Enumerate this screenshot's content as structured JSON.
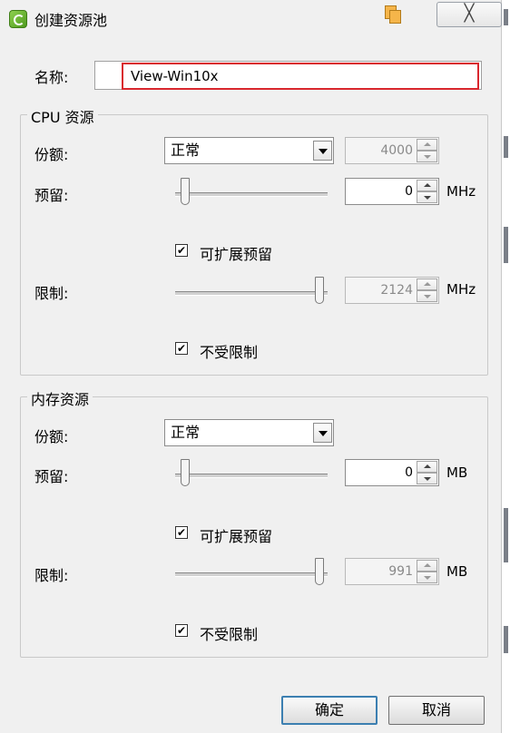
{
  "window": {
    "title": "创建资源池",
    "close_glyph": "╳"
  },
  "name": {
    "label": "名称:",
    "value": "View-Win10x"
  },
  "cpu": {
    "legend": "CPU 资源",
    "shares_label": "份额:",
    "shares_value": "正常",
    "shares_number": "4000",
    "reservation_label": "预留:",
    "reservation_value": "0",
    "reservation_unit": "MHz",
    "expandable_label": "可扩展预留",
    "expandable_checked": "✔",
    "limit_label": "限制:",
    "limit_value": "2124",
    "limit_unit": "MHz",
    "unlimited_label": "不受限制",
    "unlimited_checked": "✔"
  },
  "memory": {
    "legend": "内存资源",
    "shares_label": "份额:",
    "shares_value": "正常",
    "reservation_label": "预留:",
    "reservation_value": "0",
    "reservation_unit": "MB",
    "expandable_label": "可扩展预留",
    "expandable_checked": "✔",
    "limit_label": "限制:",
    "limit_value": "991",
    "limit_unit": "MB",
    "unlimited_label": "不受限制",
    "unlimited_checked": "✔"
  },
  "buttons": {
    "ok": "确定",
    "cancel": "取消"
  },
  "colors": {
    "highlight_border": "#d9272e",
    "dialog_bg": "#f0f0f0"
  },
  "icons": [
    "app-icon",
    "restore-window-icon",
    "close-icon",
    "dropdown-arrow-icon",
    "spin-up-icon",
    "spin-down-icon",
    "checkmark-icon"
  ]
}
